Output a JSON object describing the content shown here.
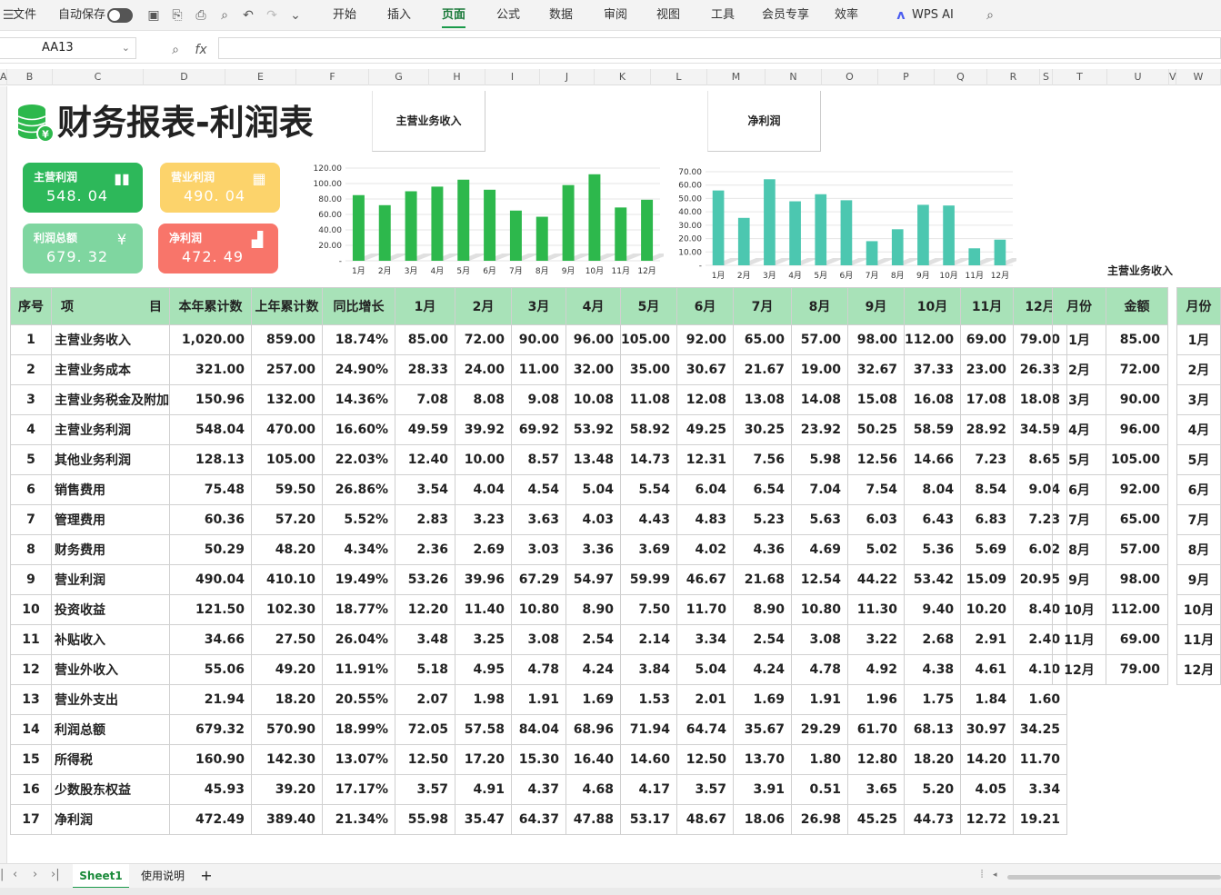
{
  "toolbar": {
    "file": "文件",
    "autosave": "自动保存",
    "menus": [
      "开始",
      "插入",
      "页面",
      "公式",
      "数据",
      "审阅",
      "视图",
      "工具",
      "会员专享",
      "效率"
    ],
    "active_menu": "页面",
    "wps_ai": "WPS AI"
  },
  "formula_bar": {
    "cell_ref": "AA13",
    "fx": "fx",
    "content": ""
  },
  "columns": [
    "A",
    "B",
    "C",
    "D",
    "E",
    "F",
    "G",
    "H",
    "I",
    "J",
    "K",
    "L",
    "M",
    "N",
    "O",
    "P",
    "Q",
    "R",
    "S",
    "T",
    "U",
    "V",
    "W"
  ],
  "title": "财务报表-利润表",
  "chart_tabs": [
    "主营业务收入",
    "净利润"
  ],
  "cards": [
    {
      "label": "主营利润",
      "value": "548. 04",
      "color": "#2db85a",
      "icon": "bar-chart-icon"
    },
    {
      "label": "营业利润",
      "value": "490. 04",
      "color": "#fcd36b",
      "icon": "calculator-icon"
    },
    {
      "label": "利润总额",
      "value": "679. 32",
      "color": "#7fd6a0",
      "icon": "money-icon"
    },
    {
      "label": "净利润",
      "value": "472. 49",
      "color": "#f8756a",
      "icon": "chart-up-icon"
    }
  ],
  "chart_data": [
    {
      "type": "bar",
      "title": "",
      "categories": [
        "1月",
        "2月",
        "3月",
        "4月",
        "5月",
        "6月",
        "7月",
        "8月",
        "9月",
        "10月",
        "11月",
        "12月"
      ],
      "series": [
        {
          "values": [
            85,
            72,
            90,
            96,
            105,
            92,
            65,
            57,
            98,
            112,
            69,
            79
          ]
        }
      ],
      "y_ticks": [
        "120.00",
        "100.00",
        "80.00",
        "60.00",
        "40.00",
        "20.00",
        "-"
      ],
      "ylim": [
        0,
        120
      ],
      "grid": true,
      "color": "#2db84c"
    },
    {
      "type": "bar",
      "title": "",
      "categories": [
        "1月",
        "2月",
        "3月",
        "4月",
        "5月",
        "6月",
        "7月",
        "8月",
        "9月",
        "10月",
        "11月",
        "12月"
      ],
      "series": [
        {
          "values": [
            55.98,
            35.47,
            64.37,
            47.88,
            53.17,
            48.67,
            18.06,
            26.98,
            45.25,
            44.73,
            12.72,
            19.21
          ]
        }
      ],
      "y_ticks": [
        "70.00",
        "60.00",
        "50.00",
        "40.00",
        "30.00",
        "20.00",
        "10.00",
        "-"
      ],
      "ylim": [
        0,
        70
      ],
      "grid": true,
      "color": "#4cc7b0"
    }
  ],
  "table": {
    "headers": [
      "序号",
      "项　　目",
      "本年累计数",
      "上年累计数",
      "同比增长",
      "1月",
      "2月",
      "3月",
      "4月",
      "5月",
      "6月",
      "7月",
      "8月",
      "9月",
      "10月",
      "11月",
      "12月"
    ],
    "rows": [
      [
        "1",
        "主营业务收入",
        "1,020.00",
        "859.00",
        "18.74%",
        "85.00",
        "72.00",
        "90.00",
        "96.00",
        "105.00",
        "92.00",
        "65.00",
        "57.00",
        "98.00",
        "112.00",
        "69.00",
        "79.00"
      ],
      [
        "2",
        "主营业务成本",
        "321.00",
        "257.00",
        "24.90%",
        "28.33",
        "24.00",
        "11.00",
        "32.00",
        "35.00",
        "30.67",
        "21.67",
        "19.00",
        "32.67",
        "37.33",
        "23.00",
        "26.33"
      ],
      [
        "3",
        "主营业务税金及附加",
        "150.96",
        "132.00",
        "14.36%",
        "7.08",
        "8.08",
        "9.08",
        "10.08",
        "11.08",
        "12.08",
        "13.08",
        "14.08",
        "15.08",
        "16.08",
        "17.08",
        "18.08"
      ],
      [
        "4",
        "主营业务利润",
        "548.04",
        "470.00",
        "16.60%",
        "49.59",
        "39.92",
        "69.92",
        "53.92",
        "58.92",
        "49.25",
        "30.25",
        "23.92",
        "50.25",
        "58.59",
        "28.92",
        "34.59"
      ],
      [
        "5",
        "其他业务利润",
        "128.13",
        "105.00",
        "22.03%",
        "12.40",
        "10.00",
        "8.57",
        "13.48",
        "14.73",
        "12.31",
        "7.56",
        "5.98",
        "12.56",
        "14.66",
        "7.23",
        "8.65"
      ],
      [
        "6",
        "销售费用",
        "75.48",
        "59.50",
        "26.86%",
        "3.54",
        "4.04",
        "4.54",
        "5.04",
        "5.54",
        "6.04",
        "6.54",
        "7.04",
        "7.54",
        "8.04",
        "8.54",
        "9.04"
      ],
      [
        "7",
        "管理费用",
        "60.36",
        "57.20",
        "5.52%",
        "2.83",
        "3.23",
        "3.63",
        "4.03",
        "4.43",
        "4.83",
        "5.23",
        "5.63",
        "6.03",
        "6.43",
        "6.83",
        "7.23"
      ],
      [
        "8",
        "财务费用",
        "50.29",
        "48.20",
        "4.34%",
        "2.36",
        "2.69",
        "3.03",
        "3.36",
        "3.69",
        "4.02",
        "4.36",
        "4.69",
        "5.02",
        "5.36",
        "5.69",
        "6.02"
      ],
      [
        "9",
        "营业利润",
        "490.04",
        "410.10",
        "19.49%",
        "53.26",
        "39.96",
        "67.29",
        "54.97",
        "59.99",
        "46.67",
        "21.68",
        "12.54",
        "44.22",
        "53.42",
        "15.09",
        "20.95"
      ],
      [
        "10",
        "投资收益",
        "121.50",
        "102.30",
        "18.77%",
        "12.20",
        "11.40",
        "10.80",
        "8.90",
        "7.50",
        "11.70",
        "8.90",
        "10.80",
        "11.30",
        "9.40",
        "10.20",
        "8.40"
      ],
      [
        "11",
        "补贴收入",
        "34.66",
        "27.50",
        "26.04%",
        "3.48",
        "3.25",
        "3.08",
        "2.54",
        "2.14",
        "3.34",
        "2.54",
        "3.08",
        "3.22",
        "2.68",
        "2.91",
        "2.40"
      ],
      [
        "12",
        "营业外收入",
        "55.06",
        "49.20",
        "11.91%",
        "5.18",
        "4.95",
        "4.78",
        "4.24",
        "3.84",
        "5.04",
        "4.24",
        "4.78",
        "4.92",
        "4.38",
        "4.61",
        "4.10"
      ],
      [
        "13",
        "营业外支出",
        "21.94",
        "18.20",
        "20.55%",
        "2.07",
        "1.98",
        "1.91",
        "1.69",
        "1.53",
        "2.01",
        "1.69",
        "1.91",
        "1.96",
        "1.75",
        "1.84",
        "1.60"
      ],
      [
        "14",
        "利润总额",
        "679.32",
        "570.90",
        "18.99%",
        "72.05",
        "57.58",
        "84.04",
        "68.96",
        "71.94",
        "64.74",
        "35.67",
        "29.29",
        "61.70",
        "68.13",
        "30.97",
        "34.25"
      ],
      [
        "15",
        "所得税",
        "160.90",
        "142.30",
        "13.07%",
        "12.50",
        "17.20",
        "15.30",
        "16.40",
        "14.60",
        "12.50",
        "13.70",
        "1.80",
        "12.80",
        "18.20",
        "14.20",
        "11.70"
      ],
      [
        "16",
        "少数股东权益",
        "45.93",
        "39.20",
        "17.17%",
        "3.57",
        "4.91",
        "4.37",
        "4.68",
        "4.17",
        "3.57",
        "3.91",
        "0.51",
        "3.65",
        "5.20",
        "4.05",
        "3.34"
      ],
      [
        "17",
        "净利润",
        "472.49",
        "389.40",
        "21.34%",
        "55.98",
        "35.47",
        "64.37",
        "47.88",
        "53.17",
        "48.67",
        "18.06",
        "26.98",
        "45.25",
        "44.73",
        "12.72",
        "19.21"
      ]
    ]
  },
  "side_label": "主营业务收入",
  "side_table": {
    "headers": [
      "月份",
      "金额"
    ],
    "rows": [
      [
        "1月",
        "85.00"
      ],
      [
        "2月",
        "72.00"
      ],
      [
        "3月",
        "90.00"
      ],
      [
        "4月",
        "96.00"
      ],
      [
        "5月",
        "105.00"
      ],
      [
        "6月",
        "92.00"
      ],
      [
        "7月",
        "65.00"
      ],
      [
        "8月",
        "57.00"
      ],
      [
        "9月",
        "98.00"
      ],
      [
        "10月",
        "112.00"
      ],
      [
        "11月",
        "69.00"
      ],
      [
        "12月",
        "79.00"
      ]
    ]
  },
  "side_table2": {
    "header": "月份",
    "rows": [
      "1月",
      "2月",
      "3月",
      "4月",
      "5月",
      "6月",
      "7月",
      "8月",
      "9月",
      "10月",
      "11月",
      "12月"
    ]
  },
  "sheet_tabs": [
    "Sheet1",
    "使用说明"
  ],
  "active_sheet": "Sheet1"
}
